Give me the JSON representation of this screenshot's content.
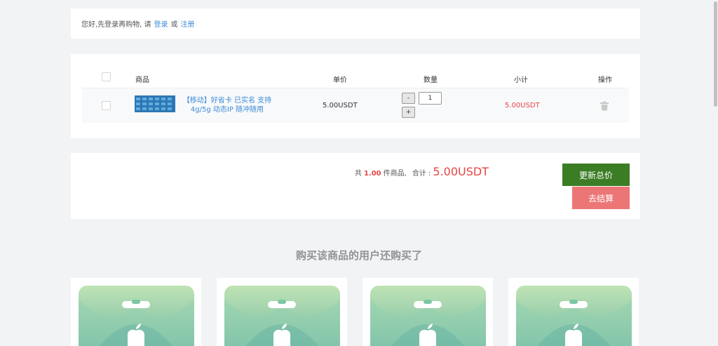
{
  "login_bar": {
    "prompt": "您好,先登录再购物, 请",
    "login_label": "登录",
    "or_label": "或",
    "register_label": "注册"
  },
  "cart": {
    "headers": {
      "product": "商品",
      "unit_price": "单价",
      "quantity": "数量",
      "subtotal": "小计",
      "action": "操作"
    },
    "items": [
      {
        "name": "【移动】好省卡 已实名 支持4g/5g 动态IP 随冲随用",
        "unit_price": "5.00USDT",
        "quantity": "1",
        "subtotal": "5.00USDT",
        "minus_label": "-",
        "plus_label": "+"
      }
    ]
  },
  "summary": {
    "count_prefix": "共",
    "count": "1.00",
    "count_suffix": "件商品,",
    "total_label": "合计 :",
    "total": "5.00USDT",
    "update_label": "更新总价",
    "checkout_label": "去结算"
  },
  "recommendations": {
    "title": "购买该商品的用户还购买了"
  },
  "colors": {
    "link": "#3d8bd6",
    "price_red": "#e64545",
    "update_green": "#3b7d25",
    "checkout_pink": "#ec7676"
  }
}
